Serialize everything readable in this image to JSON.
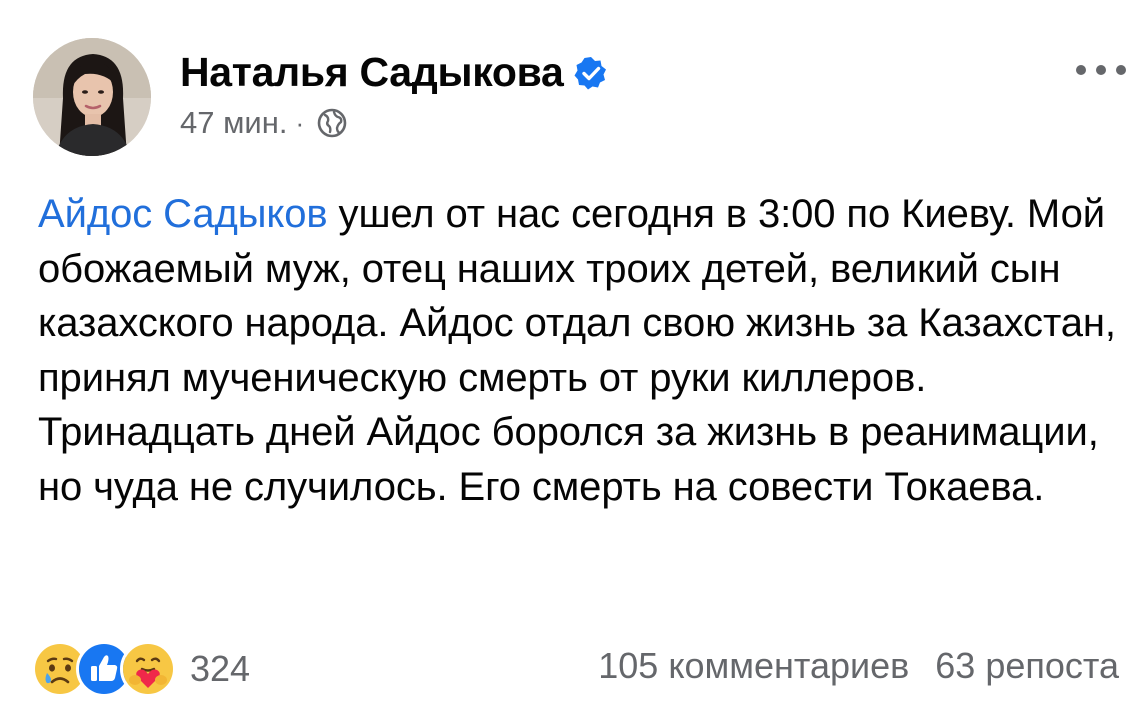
{
  "post": {
    "author_name": "Наталья Садыкова",
    "verified": true,
    "time": "47 мин.",
    "meta_separator": "·",
    "audience_icon": "globe-icon",
    "mention": "Айдос Садыков",
    "text_after_mention": " ушел от нас сегодня в 3:00 по Киеву. Мой обожаемый муж, отец наших троих детей, великий сын казахского народа. Айдос отдал свою жизнь за Казахстан, принял мученическую смерть от руки киллеров. Тринадцать дней Айдос боролся за жизнь в реанимации, но чуда не случилось. Его смерть на совести Токаева."
  },
  "reactions": {
    "icons": [
      "sad-reaction-icon",
      "like-reaction-icon",
      "care-reaction-icon"
    ],
    "count": "324"
  },
  "stats": {
    "comments": "105 комментариев",
    "shares": "63 репоста"
  },
  "colors": {
    "mention": "#216fdb",
    "secondary_text": "#65676b",
    "verified_badge": "#1877f2",
    "like_blue": "#1877f2",
    "reaction_yellow": "#f7c744"
  }
}
